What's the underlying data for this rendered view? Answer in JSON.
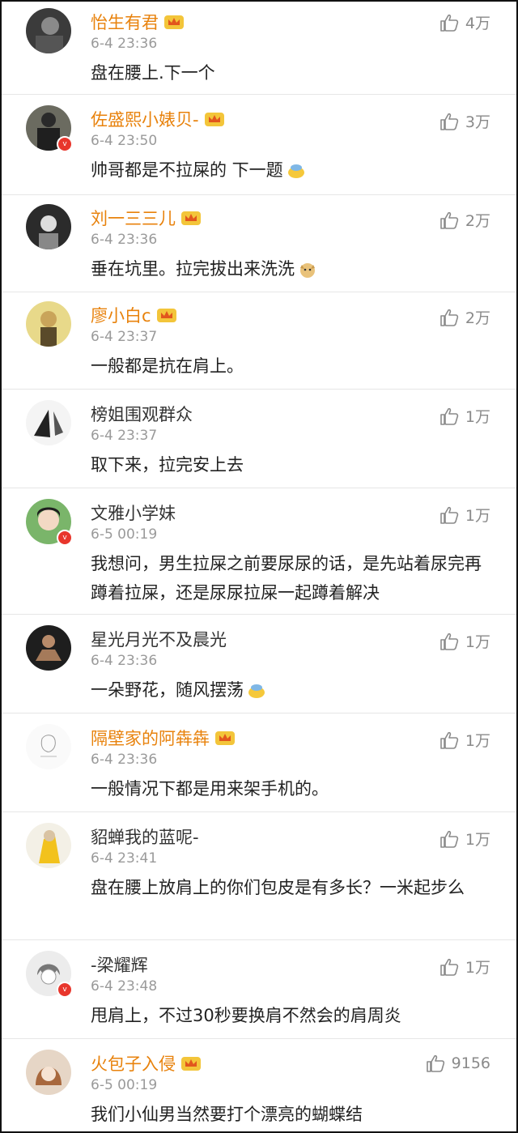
{
  "comments": [
    {
      "user": "怡生有君",
      "vip": true,
      "verified": false,
      "time": "6-4 23:36",
      "likes": "4万",
      "text": "盘在腰上.下一个",
      "emoji": ""
    },
    {
      "user": "佐盛熙小婊贝-",
      "vip": true,
      "verified": true,
      "time": "6-4 23:50",
      "likes": "3万",
      "text": "帅哥都是不拉屎的 下一题",
      "emoji": "sweat-emoji"
    },
    {
      "user": "刘一三三儿",
      "vip": true,
      "verified": false,
      "time": "6-4 23:36",
      "likes": "2万",
      "text": "垂在坑里。拉完拔出来洗洗",
      "emoji": "doge-emoji"
    },
    {
      "user": "廖小白c",
      "vip": true,
      "verified": false,
      "time": "6-4 23:37",
      "likes": "2万",
      "text": "一般都是抗在肩上。",
      "emoji": ""
    },
    {
      "user": "榜姐围观群众",
      "vip": false,
      "verified": false,
      "time": "6-4 23:37",
      "likes": "1万",
      "text": "取下来，拉完安上去",
      "emoji": ""
    },
    {
      "user": "文雅小学妹",
      "vip": false,
      "verified": true,
      "time": "6-5 00:19",
      "likes": "1万",
      "text": "我想问，男生拉屎之前要尿尿的话，是先站着尿完再蹲着拉屎，还是尿尿拉屎一起蹲着解决",
      "emoji": ""
    },
    {
      "user": "星光月光不及晨光",
      "vip": false,
      "verified": false,
      "time": "6-4 23:36",
      "likes": "1万",
      "text": "一朵野花，随风摆荡",
      "emoji": "sweat-emoji"
    },
    {
      "user": "隔壁家的阿犇犇",
      "vip": true,
      "verified": false,
      "time": "6-4 23:36",
      "likes": "1万",
      "text": "一般情况下都是用来架手机的。",
      "emoji": ""
    },
    {
      "user": "貂蝉我的蓝呢-",
      "vip": false,
      "verified": false,
      "time": "6-4 23:41",
      "likes": "1万",
      "text": "盘在腰上放肩上的你们包皮是有多长？一米起步么",
      "emoji": ""
    },
    {
      "user": "-梁耀辉",
      "vip": false,
      "verified": true,
      "time": "6-4 23:48",
      "likes": "1万",
      "text": "甩肩上，不过30秒要换肩不然会的肩周炎",
      "emoji": ""
    },
    {
      "user": "火包子入侵",
      "vip": true,
      "verified": false,
      "time": "6-5 00:19",
      "likes": "9156",
      "text": "我们小仙男当然要打个漂亮的蝴蝶结",
      "emoji": ""
    }
  ],
  "icons": {
    "like": "thumbs-up-icon",
    "vip": "crown-icon",
    "verified": "verified-v-icon"
  },
  "colors": {
    "vip_name": "#e8820c",
    "normal_name": "#333333",
    "time": "#9a9a9a",
    "divider": "#e6e6e6",
    "verified_badge": "#e8362c"
  }
}
